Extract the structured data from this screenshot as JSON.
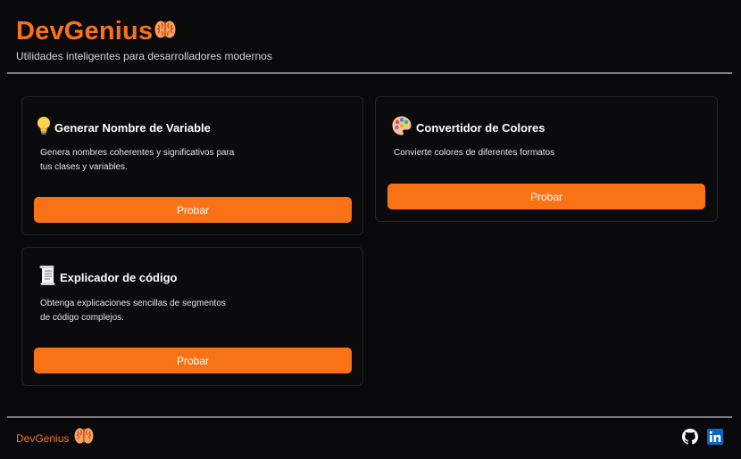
{
  "header": {
    "title": "DevGenius",
    "subtitle": "Utilidades inteligentes para desarrolladores modernos",
    "logo_icon": "brain-icon"
  },
  "tools": [
    {
      "icon": "lightbulb-icon",
      "title": "Generar Nombre de Variable",
      "description_line1": "Genera nombres coherentes y significativos para",
      "description_line2": "tus clases y variables.",
      "button_label": "Probar"
    },
    {
      "icon": "palette-icon",
      "title": "Convertidor de Colores",
      "description_line1": "Convierte colores de diferentes formatos",
      "button_label": "Probar"
    },
    {
      "icon": "scroll-icon",
      "title": "Explicador de código",
      "description_line1": "Obtenga explicaciones sencillas de segmentos",
      "description_line2": "de código complejos.",
      "button_label": "Probar"
    }
  ],
  "footer": {
    "brand": "DevGenius",
    "links": [
      "github-icon",
      "linkedin-icon"
    ]
  },
  "colors": {
    "accent": "#f97316",
    "background": "#09090b",
    "card_border": "#262629"
  }
}
